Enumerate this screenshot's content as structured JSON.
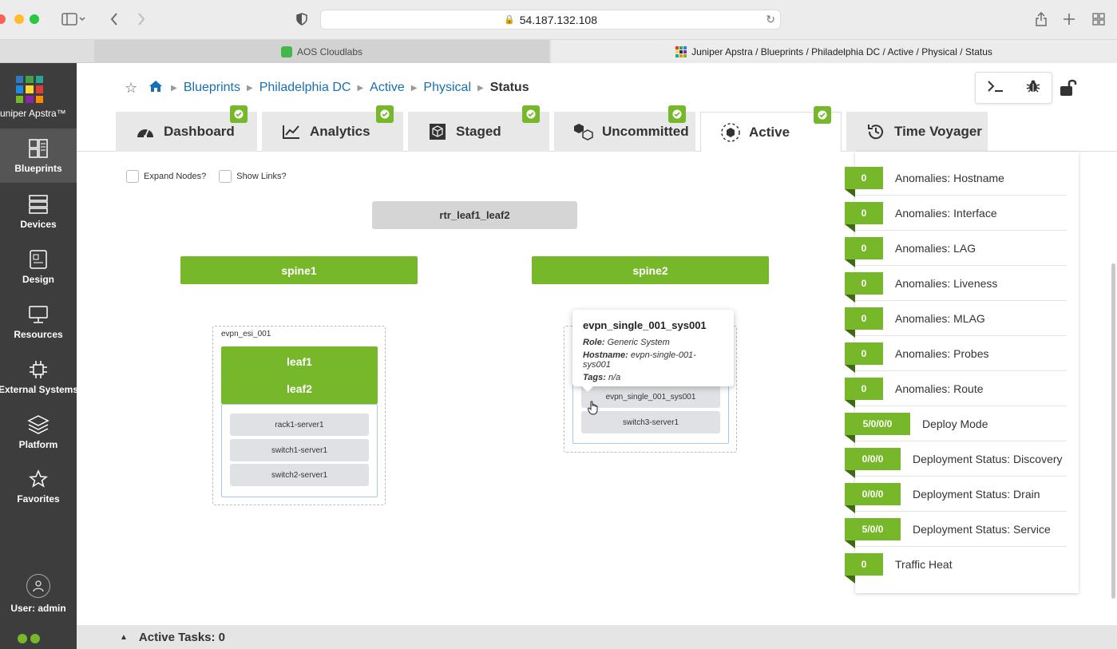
{
  "browser": {
    "url": "54.187.132.108",
    "tabs": [
      {
        "label": "AOS Cloudlabs"
      },
      {
        "label": "Juniper Apstra / Blueprints / Philadelphia DC / Active / Physical / Status"
      }
    ]
  },
  "nav": {
    "logo_text": "Juniper Apstra™",
    "items": [
      {
        "label": "Blueprints",
        "icon": "blueprints-icon"
      },
      {
        "label": "Devices",
        "icon": "devices-icon"
      },
      {
        "label": "Design",
        "icon": "design-icon"
      },
      {
        "label": "Resources",
        "icon": "resources-icon"
      },
      {
        "label": "External Systems",
        "icon": "external-systems-icon"
      },
      {
        "label": "Platform",
        "icon": "platform-icon"
      },
      {
        "label": "Favorites",
        "icon": "star-icon"
      }
    ],
    "user": "User: admin",
    "brand_green": "#76b82a",
    "nav_bg": "#3d3d3d"
  },
  "breadcrumb": {
    "items": [
      "Blueprints",
      "Philadelphia DC",
      "Active",
      "Physical"
    ],
    "current": "Status"
  },
  "tabs": [
    {
      "label": "Dashboard"
    },
    {
      "label": "Analytics"
    },
    {
      "label": "Staged"
    },
    {
      "label": "Uncommitted"
    },
    {
      "label": "Active"
    },
    {
      "label": "Time Voyager"
    }
  ],
  "options": {
    "expand_nodes": "Expand Nodes?",
    "show_links": "Show Links?"
  },
  "topology": {
    "external": "rtr_leaf1_leaf2",
    "spines": [
      "spine1",
      "spine2"
    ],
    "rack1": {
      "label": "evpn_esi_001",
      "leafs": [
        "leaf1",
        "leaf2"
      ],
      "servers": [
        "rack1-server1",
        "switch1-server1",
        "switch2-server1"
      ]
    },
    "rack2": {
      "servers": [
        "evpn_single_001_sys001",
        "switch3-server1"
      ]
    }
  },
  "tooltip": {
    "title": "evpn_single_001_sys001",
    "role_label": "Role:",
    "role": "Generic System",
    "hostname_label": "Hostname:",
    "hostname": "evpn-single-001-sys001",
    "tags_label": "Tags:",
    "tags": "n/a"
  },
  "anomalies": [
    {
      "value": "0",
      "label": "Anomalies: Hostname"
    },
    {
      "value": "0",
      "label": "Anomalies: Interface"
    },
    {
      "value": "0",
      "label": "Anomalies: LAG"
    },
    {
      "value": "0",
      "label": "Anomalies: Liveness"
    },
    {
      "value": "0",
      "label": "Anomalies: MLAG"
    },
    {
      "value": "0",
      "label": "Anomalies: Probes"
    },
    {
      "value": "0",
      "label": "Anomalies: Route"
    },
    {
      "value": "5/0/0/0",
      "label": "Deploy Mode"
    },
    {
      "value": "0/0/0",
      "label": "Deployment Status: Discovery"
    },
    {
      "value": "0/0/0",
      "label": "Deployment Status: Drain"
    },
    {
      "value": "5/0/0",
      "label": "Deployment Status: Service"
    },
    {
      "value": "0",
      "label": "Traffic Heat"
    }
  ],
  "footer": {
    "active_tasks": "Active Tasks: 0"
  }
}
